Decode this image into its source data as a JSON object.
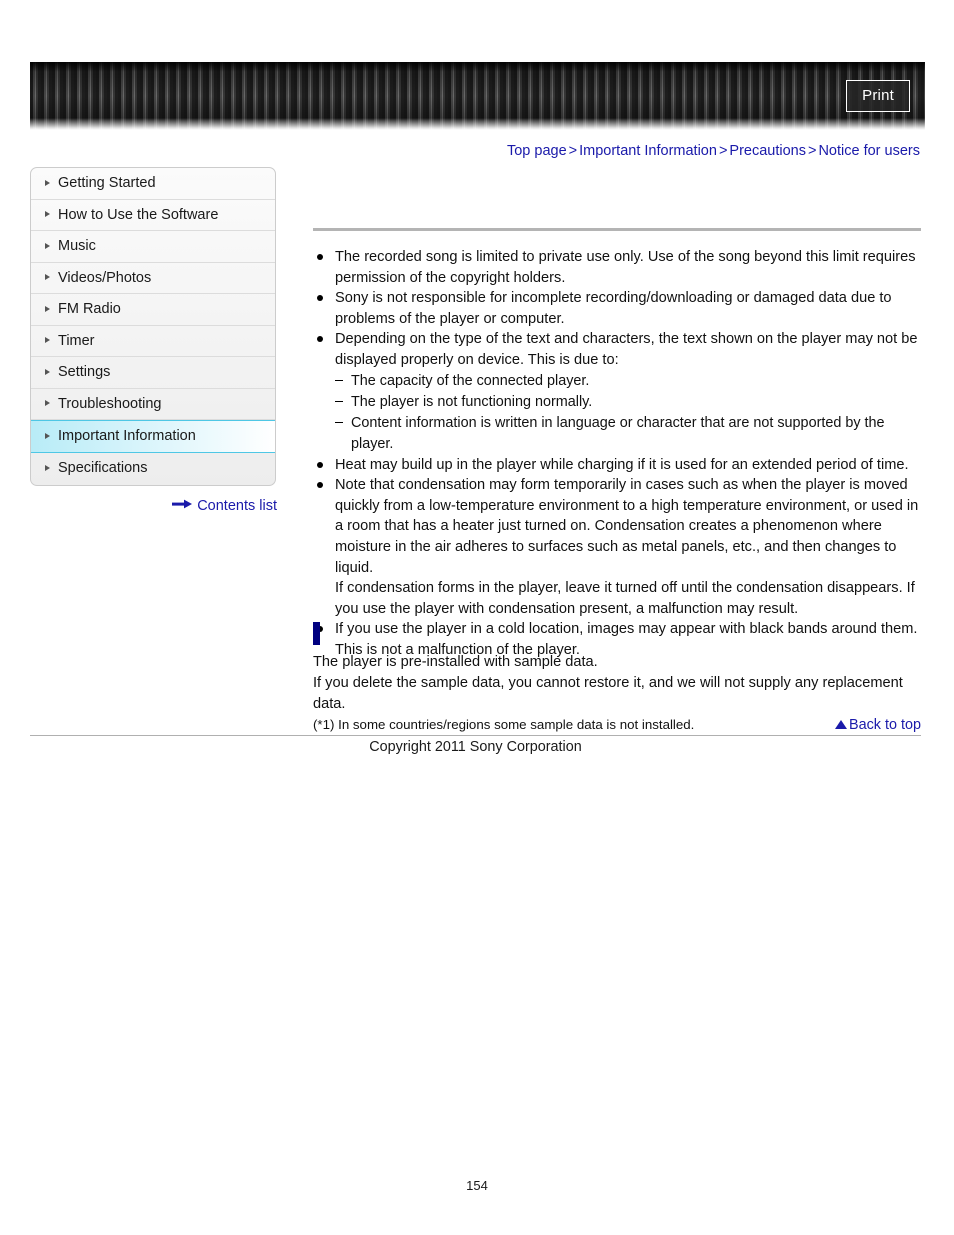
{
  "header": {
    "print_label": "Print"
  },
  "breadcrumb": {
    "separator": ">",
    "items": [
      {
        "label": "Top page"
      },
      {
        "label": "Important Information"
      },
      {
        "label": "Precautions"
      },
      {
        "label": "Notice for users"
      }
    ]
  },
  "sidebar": {
    "items": [
      {
        "label": "Getting Started",
        "active": false
      },
      {
        "label": "How to Use the Software",
        "active": false
      },
      {
        "label": "Music",
        "active": false
      },
      {
        "label": "Videos/Photos",
        "active": false
      },
      {
        "label": "FM Radio",
        "active": false
      },
      {
        "label": "Timer",
        "active": false
      },
      {
        "label": "Settings",
        "active": false
      },
      {
        "label": "Troubleshooting",
        "active": false
      },
      {
        "label": "Important Information",
        "active": true
      },
      {
        "label": "Specifications",
        "active": false
      }
    ],
    "contents_list_label": "Contents list"
  },
  "content": {
    "bullets": [
      {
        "text": "The recorded song is limited to private use only. Use of the song beyond this limit requires permission of the copyright holders."
      },
      {
        "text": "Sony is not responsible for incomplete recording/downloading or damaged data due to problems of the player or computer."
      },
      {
        "text": "Depending on the type of the text and characters, the text shown on the player may not be displayed properly on device. This is due to:",
        "subitems": [
          "The capacity of the connected player.",
          "The player is not functioning normally.",
          "Content information is written in language or character that are not supported by the player."
        ]
      },
      {
        "text": "Heat may build up in the player while charging if it is used for an extended period of time."
      },
      {
        "text": "Note that condensation may form temporarily in cases such as when the player is moved quickly from a low-temperature environment to a high temperature environment, or used in a room that has a heater just turned on. Condensation creates a phenomenon where moisture in the air adheres to surfaces such as metal panels, etc., and then changes to liquid.",
        "extra": "If condensation forms in the player, leave it turned off until the condensation disappears. If you use the player with condensation present, a malfunction may result."
      },
      {
        "text": "If you use the player in a cold location, images may appear with black bands around them. This is not a malfunction of the player."
      }
    ],
    "sample_section": {
      "heading": "",
      "line1": "The player is pre-installed with sample data.",
      "line2": "If you delete the sample data, you cannot restore it, and we will not supply any replacement data.",
      "note": "(*1) In some countries/regions some sample data is not installed."
    },
    "back_to_top_label": "Back to top"
  },
  "footer": {
    "copyright": "Copyright 2011 Sony Corporation",
    "page_number": "154"
  },
  "colors": {
    "link": "#1a1aaa",
    "marker": "#000080",
    "active_nav": "#b8ecf7",
    "rule": "#b4b4b4"
  }
}
